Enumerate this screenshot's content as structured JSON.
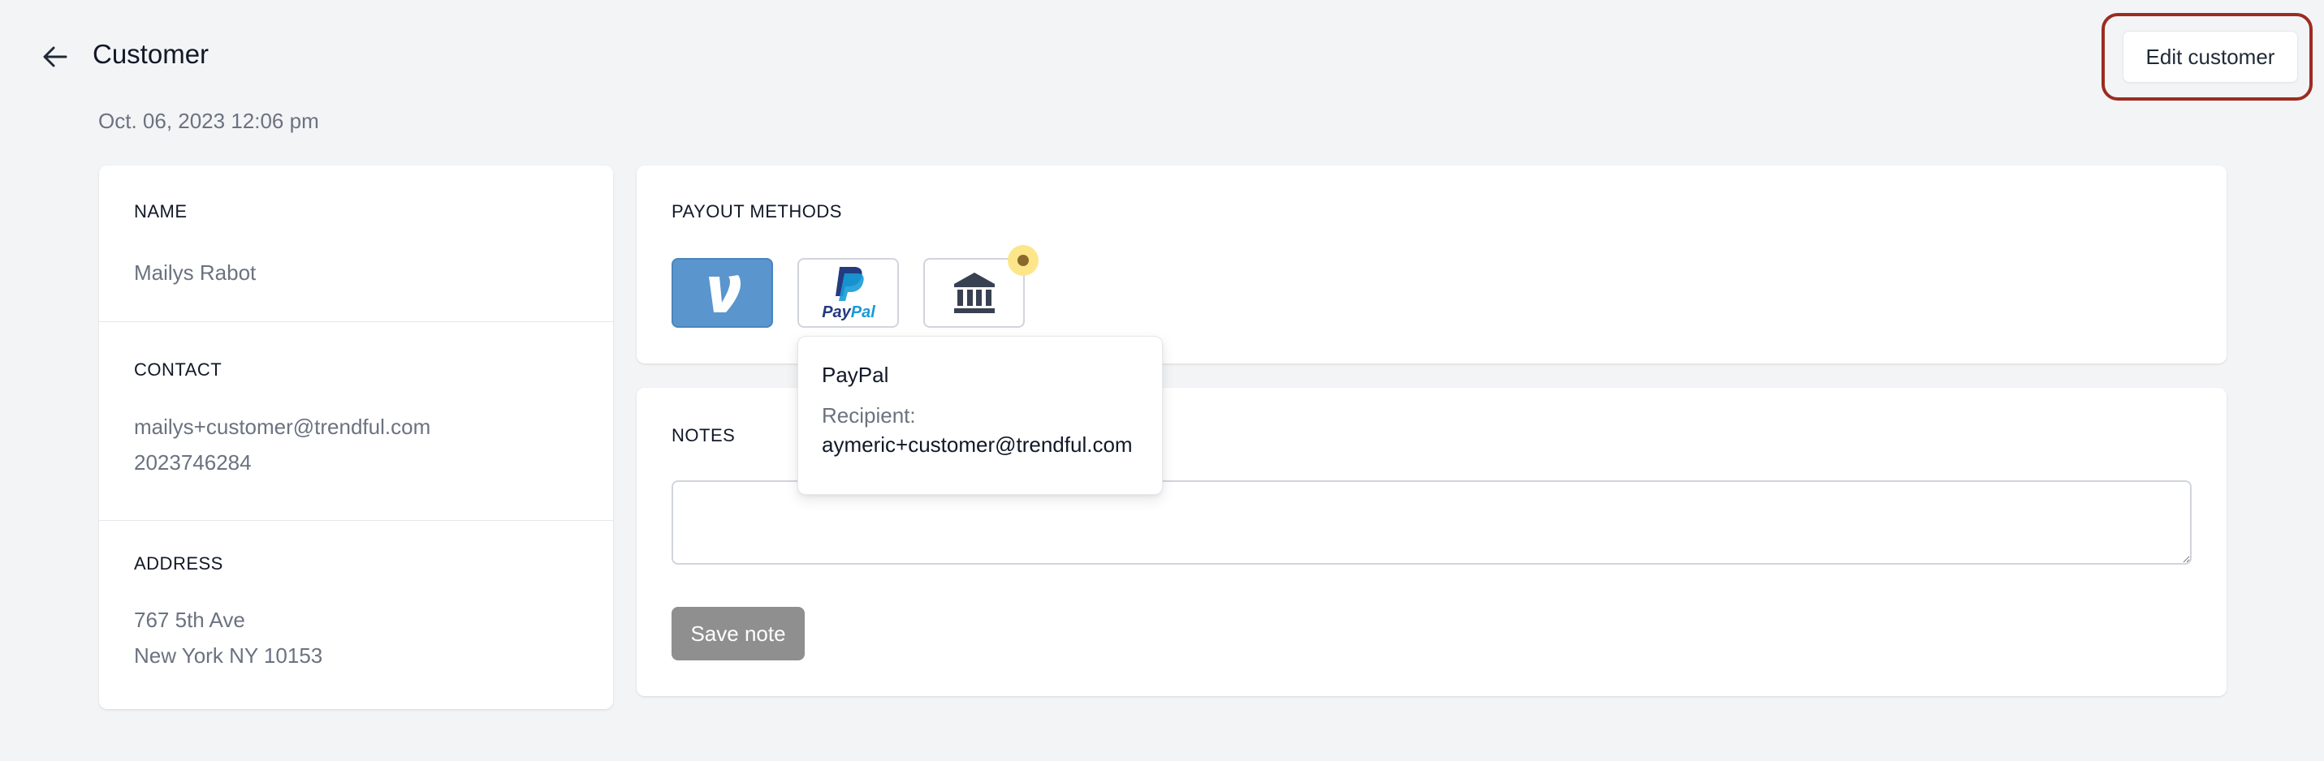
{
  "header": {
    "title": "Customer",
    "date": "Oct. 06, 2023 12:06 pm",
    "back_icon": "arrow-left-icon",
    "edit_label": "Edit customer",
    "highlight_color": "#9b2c20"
  },
  "customer": {
    "name_label": "NAME",
    "name": "Mailys Rabot",
    "contact_label": "CONTACT",
    "email": "mailys+customer@trendful.com",
    "phone": "2023746284",
    "address_label": "ADDRESS",
    "address_line1": "767 5th Ave",
    "address_line2": "New York NY 10153"
  },
  "payout": {
    "title": "PAYOUT METHODS",
    "methods": [
      {
        "name": "Venmo",
        "icon": "venmo-icon",
        "color": "#5a95cd"
      },
      {
        "name": "PayPal",
        "icon": "paypal-icon",
        "logo_text": "PayPal"
      },
      {
        "name": "Bank",
        "icon": "bank-icon"
      }
    ],
    "badge_color": "#fde68a"
  },
  "tooltip": {
    "title": "PayPal",
    "recipient_label": "Recipient:",
    "recipient": "aymeric+customer@trendful.com"
  },
  "notes": {
    "title": "NOTES",
    "value": "",
    "placeholder": "",
    "save_label": "Save note",
    "save_color": "#8f8f8f"
  }
}
